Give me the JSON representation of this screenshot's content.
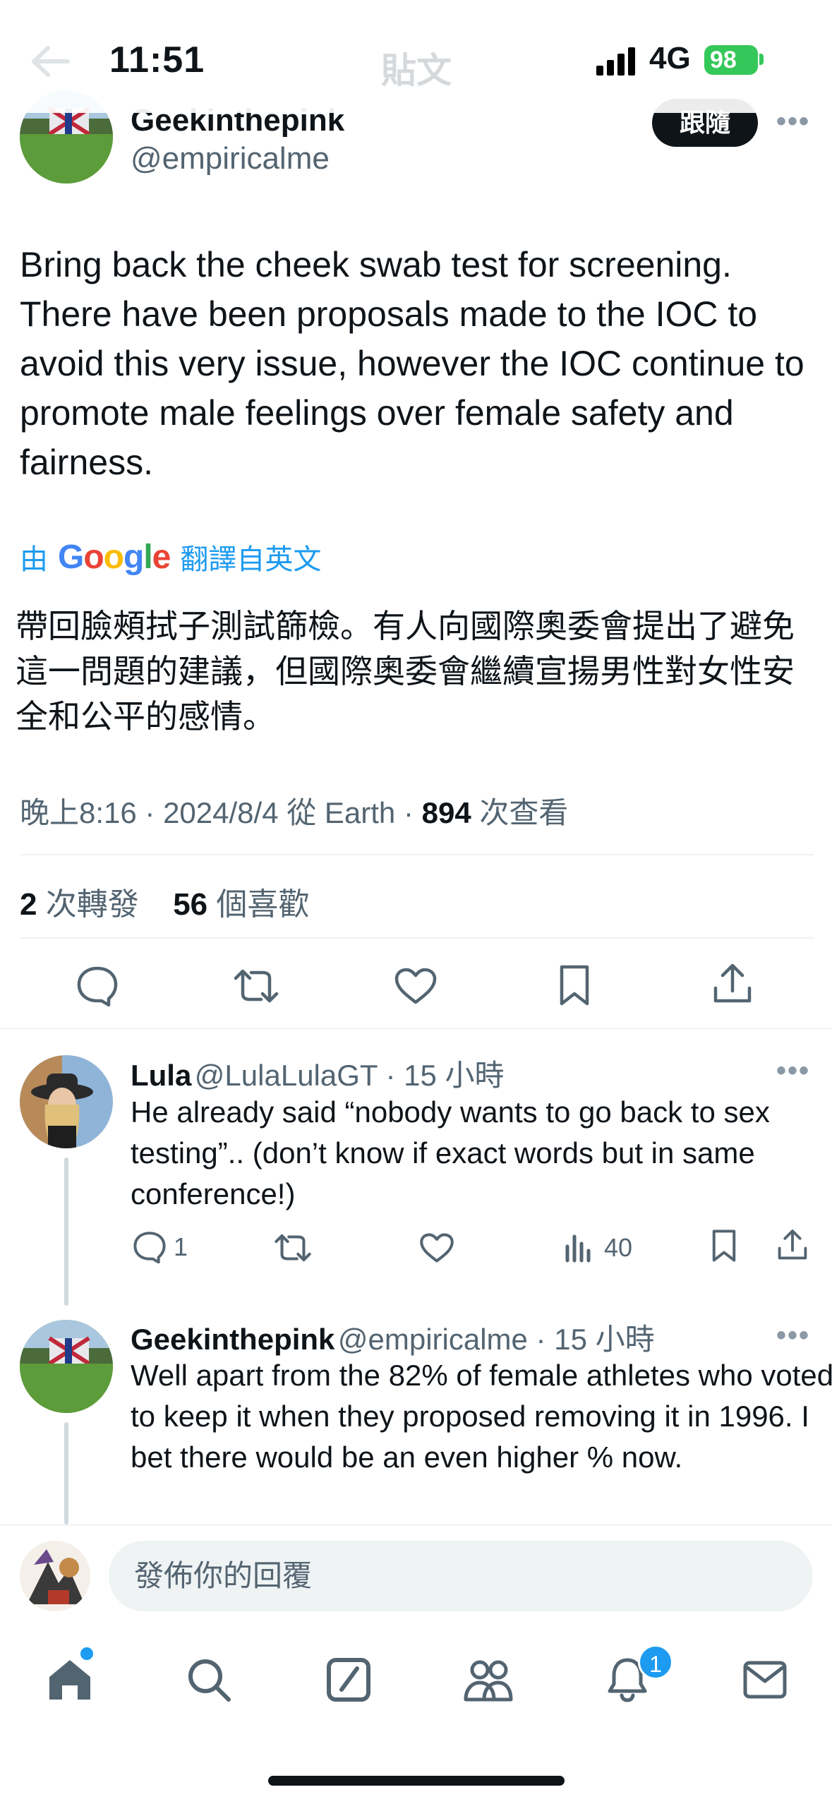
{
  "status_bar": {
    "time": "11:51",
    "network": "4G",
    "battery": "98"
  },
  "header": {
    "title": "貼文"
  },
  "author": {
    "name": "Geekinthepink",
    "handle": "@empiricalme",
    "follow_label": "跟隨"
  },
  "tweet": {
    "text": "Bring back the cheek swab test for screening. There have been proposals made to the IOC to avoid this very issue, however the IOC continue to promote male feelings over female safety and fairness.",
    "translate_prefix": "由",
    "translate_brand": "Google",
    "translate_suffix": "翻譯自英文",
    "translated_text": "帶回臉頰拭子測試篩檢。有人向國際奧委會提出了避免這一問題的建議，但國際奧委會繼續宣揚男性對女性安全和公平的感情。",
    "meta_time": "晚上8:16 · 2024/8/4 從 Earth · ",
    "views_count": "894",
    "views_label": " 次查看",
    "retweets_count": "2",
    "retweets_label": " 次轉發",
    "likes_count": "56",
    "likes_label": " 個喜歡"
  },
  "replies": [
    {
      "name": "Lula",
      "handle": "@LulaLulaGT · 15 小時",
      "text": "He already said “nobody wants to go back to sex testing”.. (don’t know if exact words but in same conference!)",
      "reply_count": "1",
      "views": "40"
    },
    {
      "name": "Geekinthepink",
      "handle": "@empiricalme · 15 小時",
      "text": "Well apart from the 82% of female athletes who voted to keep it when they proposed removing it in 1996. I bet there would be an even higher % now."
    }
  ],
  "composer": {
    "placeholder": "發佈你的回覆"
  },
  "tabbar": {
    "notification_count": "1"
  },
  "colors": {
    "accent": "#1d9bf0",
    "text": "#0f1419",
    "muted": "#536471",
    "battery": "#34c759"
  }
}
